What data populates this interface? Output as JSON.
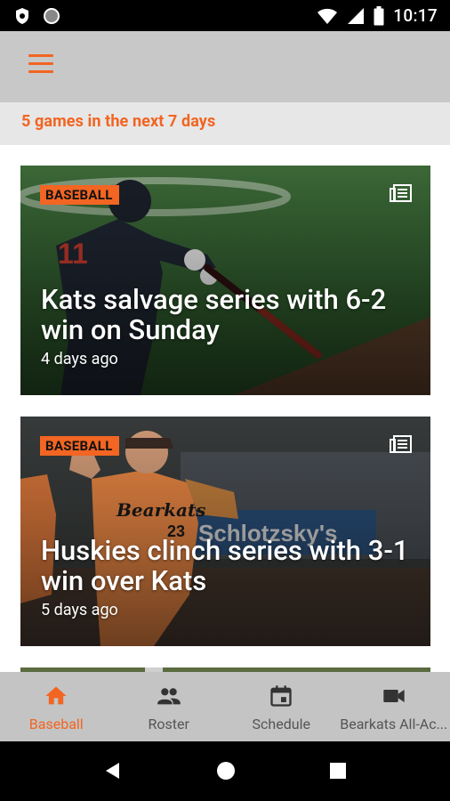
{
  "status_bar": {
    "time": "10:17",
    "icons": [
      "shield-icon",
      "dot-icon",
      "wifi-icon",
      "signal-icon",
      "battery-icon"
    ]
  },
  "app_bar": {
    "menu_icon": "hamburger-menu-icon"
  },
  "games_banner": {
    "text": "5 games in the next 7 days"
  },
  "feed": {
    "cards": [
      {
        "badge": "BASEBALL",
        "title": "Kats salvage series with 6-2 win on Sunday",
        "time": "4 days ago",
        "icon": "article-icon"
      },
      {
        "badge": "BASEBALL",
        "title": "Huskies clinch series with 3-1 win over Kats",
        "time": "5 days ago",
        "icon": "article-icon"
      }
    ]
  },
  "bottom_nav": {
    "items": [
      {
        "label": "Baseball",
        "icon": "home-icon",
        "active": true
      },
      {
        "label": "Roster",
        "icon": "people-icon",
        "active": false
      },
      {
        "label": "Schedule",
        "icon": "calendar-icon",
        "active": false
      },
      {
        "label": "Bearkats All-Ac...",
        "icon": "video-camera-icon",
        "active": false
      }
    ]
  },
  "colors": {
    "accent": "#f26522",
    "app_bar": "#c8c8c8",
    "banner_bg": "#e7e7e7",
    "bottom_nav_bg": "#c4c4c4",
    "inactive_label": "#555555"
  },
  "system_nav": {
    "buttons": [
      "back-icon",
      "home-circle-icon",
      "recents-icon"
    ]
  }
}
